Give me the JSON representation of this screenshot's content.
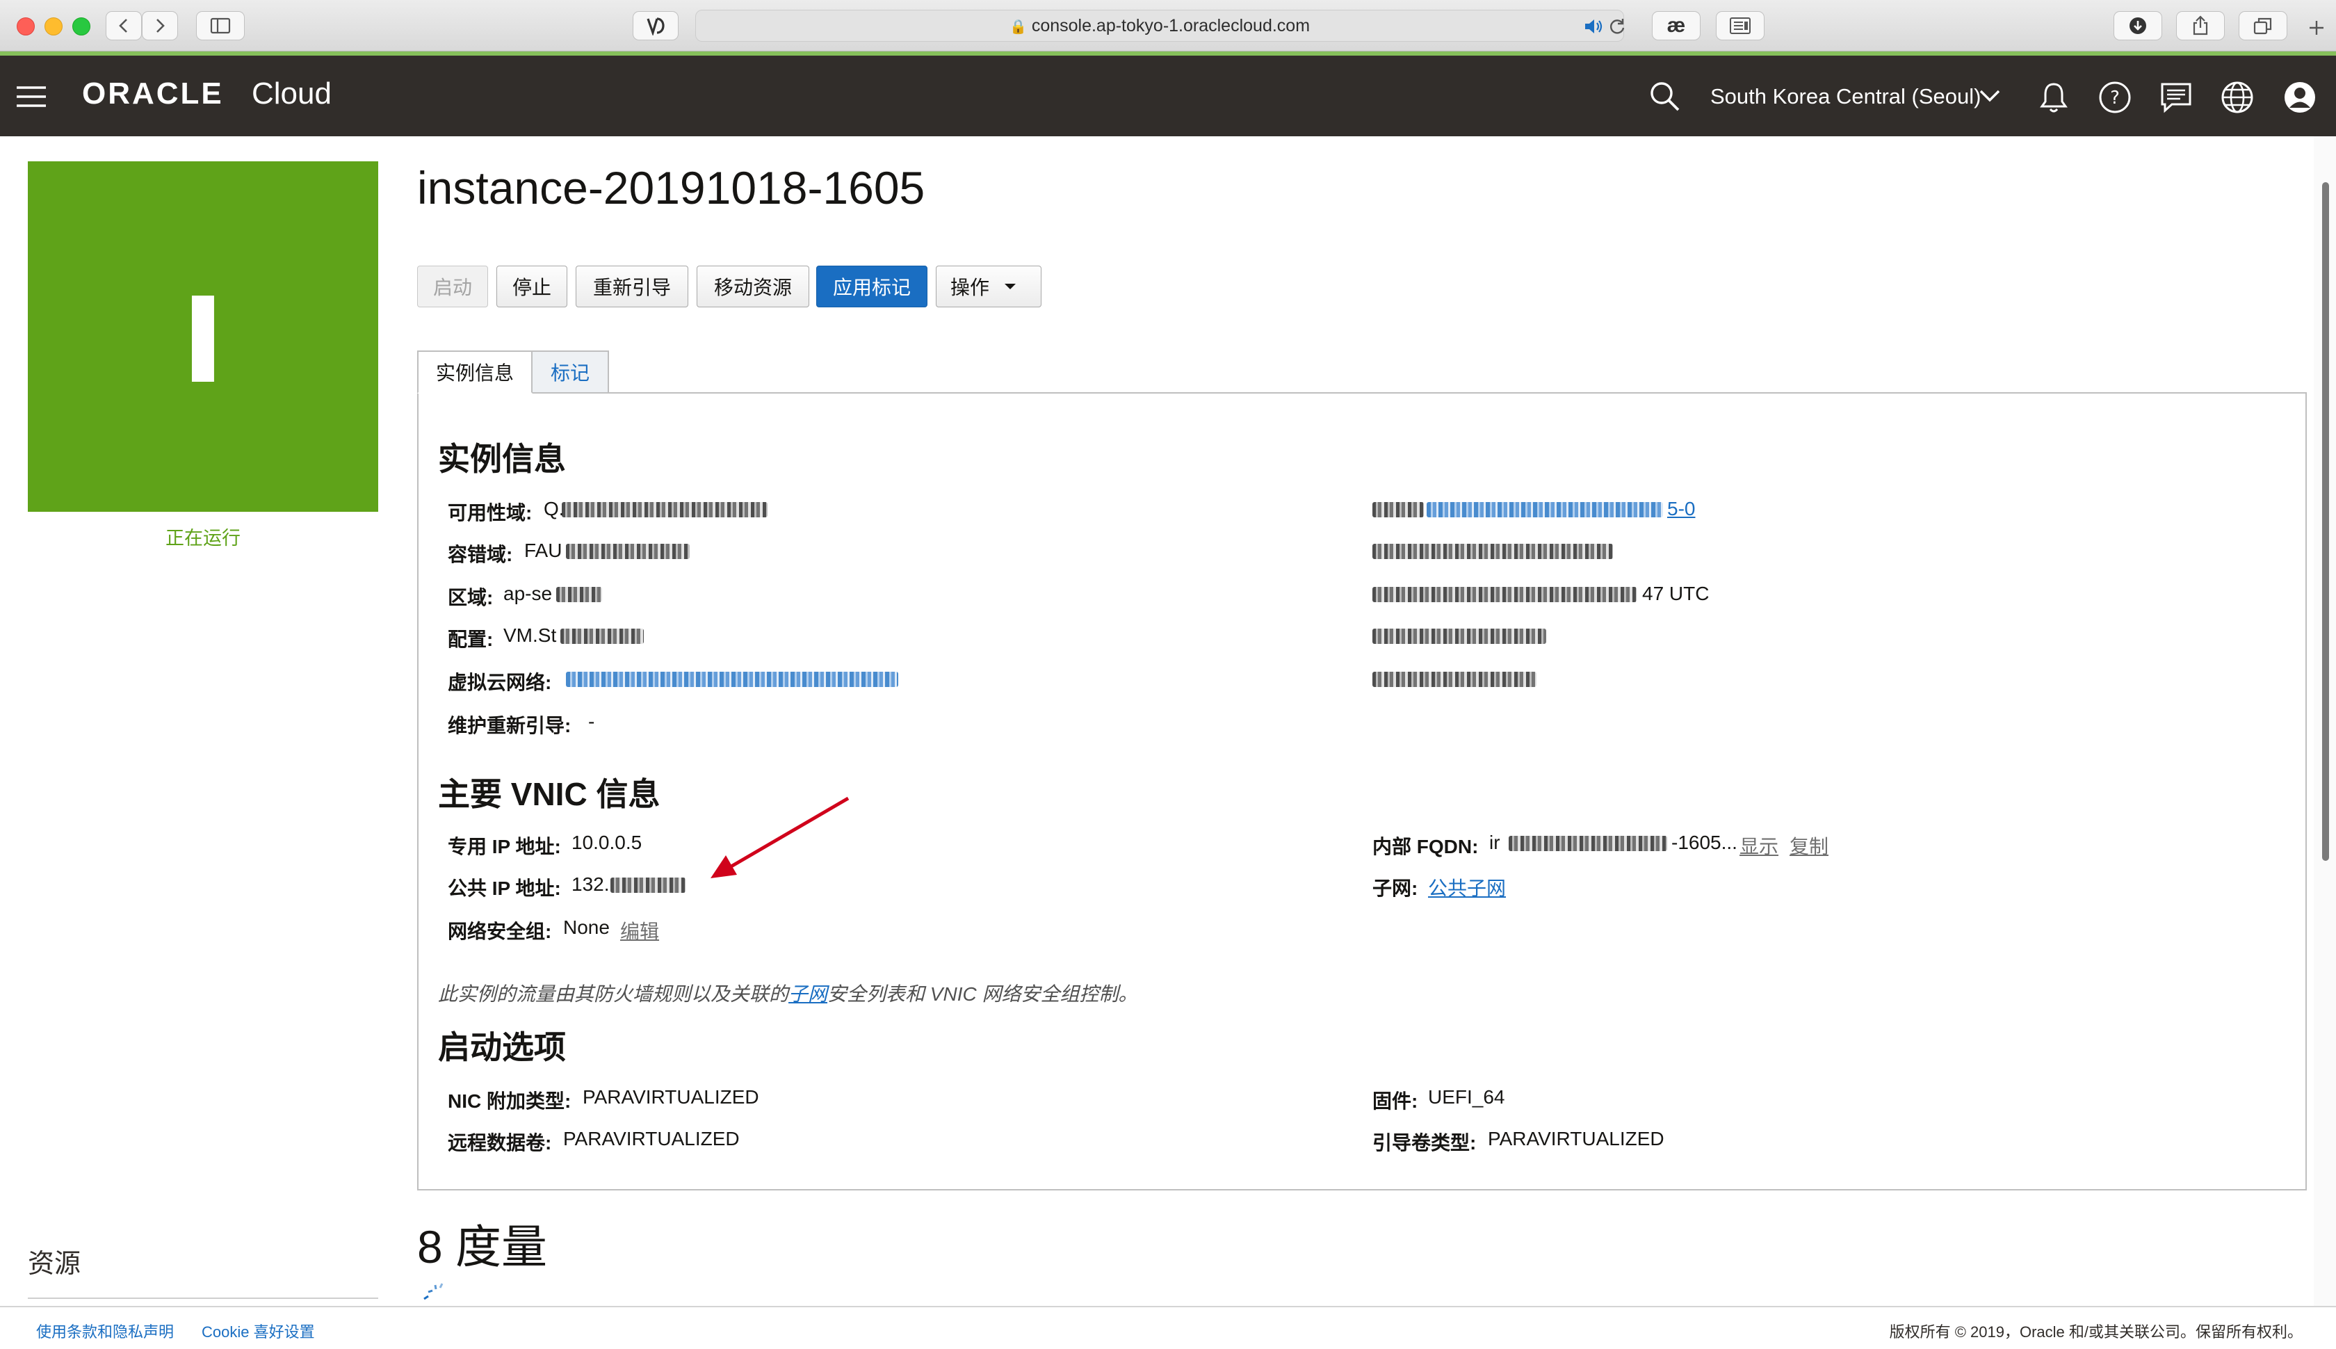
{
  "browser": {
    "url": "console.ap-tokyo-1.oraclecloud.com"
  },
  "header": {
    "logo_oracle": "ORACLE",
    "logo_cloud": "Cloud",
    "region": "South Korea Central (Seoul)",
    "icons": [
      "menu-icon",
      "search-icon",
      "bell-icon",
      "help-icon",
      "chat-icon",
      "globe-icon",
      "user-icon"
    ]
  },
  "instance": {
    "tile_letter": "I",
    "tile_color": "#5fa319",
    "status": "正在运行",
    "name": "instance-20191018-1605"
  },
  "actions": {
    "start": "启动",
    "stop": "停止",
    "reboot": "重新引导",
    "move": "移动资源",
    "apply_tags": "应用标记",
    "more": "操作"
  },
  "tabs": {
    "info": "实例信息",
    "tags": "标记"
  },
  "instance_info": {
    "title": "实例信息",
    "availability_domain_label": "可用性域:",
    "availability_domain_value": "Q.",
    "fault_domain_label": "容错域:",
    "fault_domain_value": "FAU",
    "region_label": "区域:",
    "region_value": "ap-se",
    "shape_label": "配置:",
    "shape_value": "VM.St",
    "vcn_label": "虚拟云网络:",
    "maintenance_label": "维护重新引导:",
    "maintenance_value": "-",
    "right_link_suffix": "5-0",
    "launched_suffix": "47 UTC"
  },
  "vnic": {
    "title": "主要 VNIC 信息",
    "private_ip_label": "专用 IP 地址:",
    "private_ip_value": "10.0.0.5",
    "public_ip_label": "公共 IP 地址:",
    "public_ip_value": "132.",
    "nsg_label": "网络安全组:",
    "nsg_value": "None",
    "nsg_edit": "编辑",
    "fqdn_label": "内部 FQDN:",
    "fqdn_prefix": "ir",
    "fqdn_suffix": "-1605...",
    "fqdn_show": "显示",
    "fqdn_copy": "复制",
    "subnet_label": "子网:",
    "subnet_value": "公共子网",
    "note_before": "此实例的流量由其防火墙规则以及关联的",
    "note_link": "子网",
    "note_after": "安全列表和 VNIC 网络安全组控制。"
  },
  "launch_options": {
    "title": "启动选项",
    "nic_label": "NIC 附加类型:",
    "nic_value": "PARAVIRTUALIZED",
    "remote_volume_label": "远程数据卷:",
    "remote_volume_value": "PARAVIRTUALIZED",
    "firmware_label": "固件:",
    "firmware_value": "UEFI_64",
    "boot_volume_label": "引导卷类型:",
    "boot_volume_value": "PARAVIRTUALIZED"
  },
  "metrics": {
    "title": "8 度量"
  },
  "sidebar": {
    "resources_title": "资源"
  },
  "footer": {
    "terms": "使用条款和隐私声明",
    "cookie": "Cookie 喜好设置",
    "copyright": "版权所有 © 2019，Oracle 和/或其关联公司。保留所有权利。"
  },
  "colors": {
    "header_bg": "#312d2a",
    "primary_button": "#1a6ec2",
    "status_green": "#5fa319",
    "annotation_arrow": "#d0021b"
  }
}
